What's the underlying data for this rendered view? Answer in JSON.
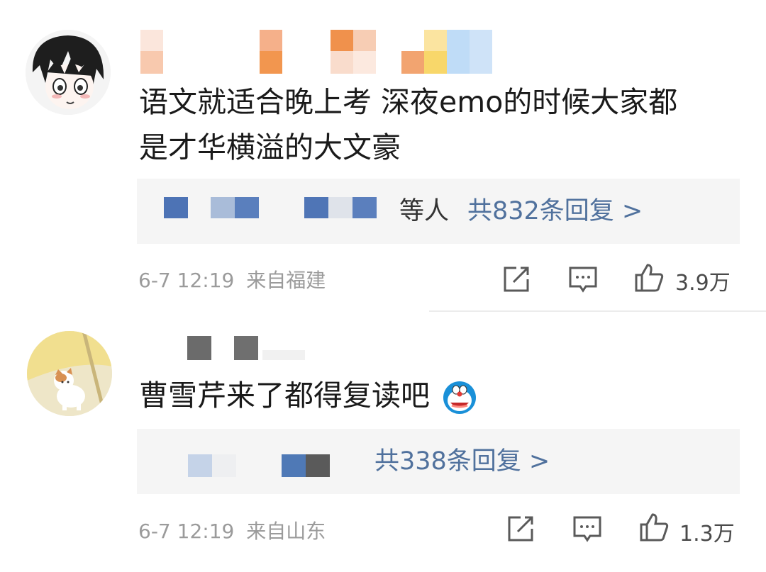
{
  "comments": [
    {
      "text_line1": "语文就适合晚上考 深夜emo的时候大家都",
      "text_line2": "是才华横溢的大文豪",
      "reply_prefix": "等人",
      "reply_link": "共832条回复 >",
      "timestamp": "6-7 12:19",
      "location": "来自福建",
      "likes": "3.9万"
    },
    {
      "text_line1": "曹雪芹来了都得复读吧",
      "emoji": "doraemon-emoji",
      "reply_link": "共338条回复 >",
      "timestamp": "6-7 12:19",
      "location": "来自山东",
      "likes": "1.3万"
    }
  ],
  "colors": {
    "link": "#50719d",
    "meta": "#9b9b9b",
    "reply_bg": "#f5f5f5"
  }
}
